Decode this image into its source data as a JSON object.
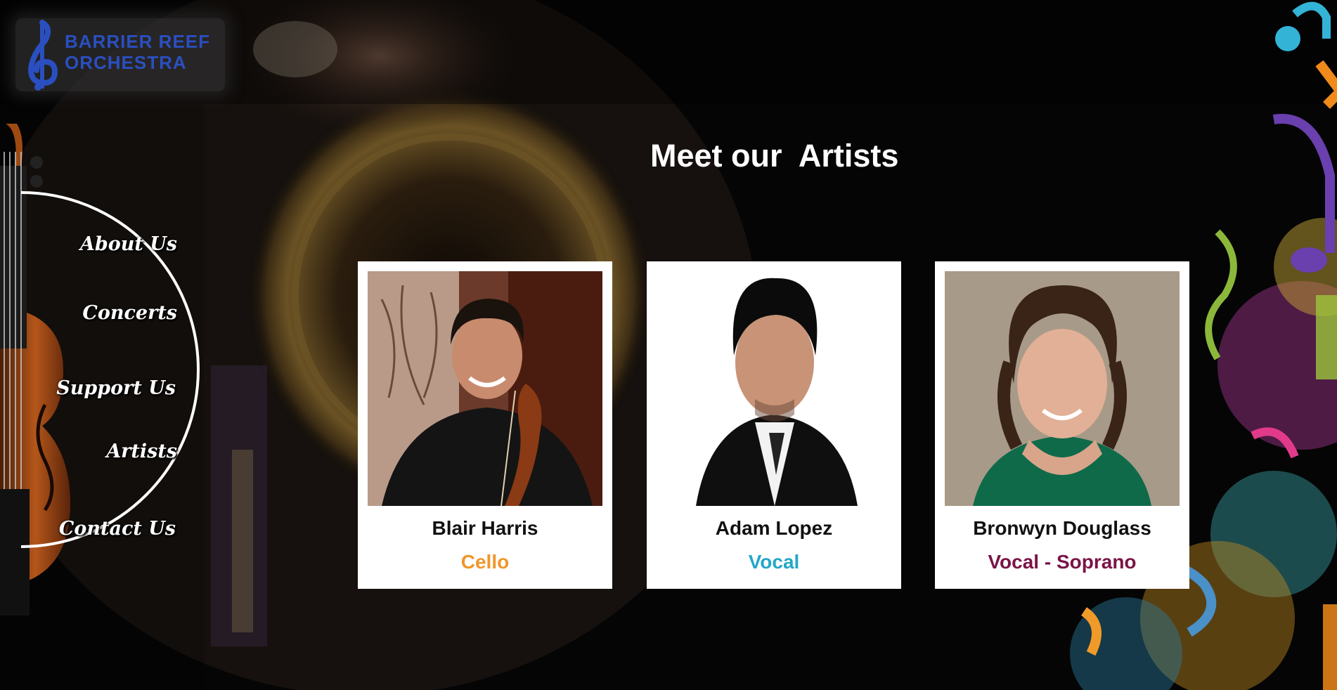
{
  "brand": {
    "name_line1": "BARRIER REEF",
    "name_line2": "ORCHESTRA",
    "logo_color": "#2a4fc0"
  },
  "nav": {
    "items": [
      {
        "label": "About Us"
      },
      {
        "label": "Concerts"
      },
      {
        "label": "Support Us"
      },
      {
        "label": "Artists"
      },
      {
        "label": "Contact Us"
      }
    ]
  },
  "page": {
    "title": "Meet our  Artists"
  },
  "artists": [
    {
      "name": "Blair Harris",
      "role": "Cello",
      "role_color": "#f0962b"
    },
    {
      "name": "Adam Lopez",
      "role": "Vocal",
      "role_color": "#24a7c9"
    },
    {
      "name": "Bronwyn Douglass",
      "role": "Vocal - Soprano",
      "role_color": "#7a1446"
    }
  ],
  "icons": {
    "logo": "treble-clef-icon",
    "violin": "violin-image",
    "decor": "music-notes-image"
  }
}
